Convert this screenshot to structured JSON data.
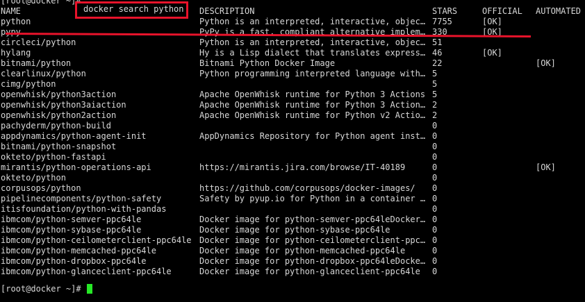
{
  "terminal": {
    "top_prompt": "[root@docker ~]#",
    "command": "docker search python",
    "final_prompt": "[root@docker ~]#"
  },
  "table": {
    "headers": {
      "name": "NAME",
      "description": "DESCRIPTION",
      "stars": "STARS",
      "official": "OFFICIAL",
      "automated": "AUTOMATED"
    },
    "rows": [
      {
        "name": "python",
        "description": "Python is an interpreted, interactive, objec…",
        "stars": "7755",
        "official": "[OK]",
        "automated": ""
      },
      {
        "name": "pypy",
        "description": "PyPy is a fast, compliant alternative implem…",
        "stars": "330",
        "official": "[OK]",
        "automated": ""
      },
      {
        "name": "circleci/python",
        "description": "Python is an interpreted, interactive, objec…",
        "stars": "51",
        "official": "",
        "automated": ""
      },
      {
        "name": "hylang",
        "description": "Hy is a Lisp dialect that translates express…",
        "stars": "46",
        "official": "[OK]",
        "automated": ""
      },
      {
        "name": "bitnami/python",
        "description": "Bitnami Python Docker Image",
        "stars": "22",
        "official": "",
        "automated": "[OK]"
      },
      {
        "name": "clearlinux/python",
        "description": "Python programming interpreted language with…",
        "stars": "5",
        "official": "",
        "automated": ""
      },
      {
        "name": "cimg/python",
        "description": "",
        "stars": "5",
        "official": "",
        "automated": ""
      },
      {
        "name": "openwhisk/python3action",
        "description": "Apache OpenWhisk runtime for Python 3 Actions",
        "stars": "5",
        "official": "",
        "automated": ""
      },
      {
        "name": "openwhisk/python3aiaction",
        "description": "Apache OpenWhisk runtime for Python 3 Action…",
        "stars": "2",
        "official": "",
        "automated": ""
      },
      {
        "name": "openwhisk/python2action",
        "description": "Apache OpenWhisk runtime for Python v2 Actio…",
        "stars": "2",
        "official": "",
        "automated": ""
      },
      {
        "name": "pachyderm/python-build",
        "description": "",
        "stars": "0",
        "official": "",
        "automated": ""
      },
      {
        "name": "appdynamics/python-agent-init",
        "description": "AppDynamics Repository for Python agent inst…",
        "stars": "0",
        "official": "",
        "automated": ""
      },
      {
        "name": "bitnami/python-snapshot",
        "description": "",
        "stars": "0",
        "official": "",
        "automated": ""
      },
      {
        "name": "okteto/python-fastapi",
        "description": "",
        "stars": "0",
        "official": "",
        "automated": ""
      },
      {
        "name": "mirantis/python-operations-api",
        "description": "https://mirantis.jira.com/browse/IT-40189",
        "stars": "0",
        "official": "",
        "automated": "[OK]"
      },
      {
        "name": "okteto/python",
        "description": "",
        "stars": "0",
        "official": "",
        "automated": ""
      },
      {
        "name": "corpusops/python",
        "description": "https://github.com/corpusops/docker-images/",
        "stars": "0",
        "official": "",
        "automated": ""
      },
      {
        "name": "pipelinecomponents/python-safety",
        "description": "Safety by pyup.io for Python in a container …",
        "stars": "0",
        "official": "",
        "automated": ""
      },
      {
        "name": "itisfoundation/python-with-pandas",
        "description": "",
        "stars": "0",
        "official": "",
        "automated": ""
      },
      {
        "name": "ibmcom/python-semver-ppc64le",
        "description": "Docker image for python-semver-ppc64leDocker…",
        "stars": "0",
        "official": "",
        "automated": ""
      },
      {
        "name": "ibmcom/python-sybase-ppc64le",
        "description": "Docker image for python-sybase-ppc64le",
        "stars": "0",
        "official": "",
        "automated": ""
      },
      {
        "name": "ibmcom/python-ceilometerclient-ppc64le",
        "description": "Docker image for python-ceilometerclient-ppc…",
        "stars": "0",
        "official": "",
        "automated": ""
      },
      {
        "name": "ibmcom/python-memcached-ppc64le",
        "description": "Docker image for python-memcached-ppc64le",
        "stars": "0",
        "official": "",
        "automated": ""
      },
      {
        "name": "ibmcom/python-dropbox-ppc64le",
        "description": "Docker image for python-dropbox-ppc64leDocke…",
        "stars": "0",
        "official": "",
        "automated": ""
      },
      {
        "name": "ibmcom/python-glanceclient-ppc64le",
        "description": "Docker image for python-glanceclient-ppc64le",
        "stars": "0",
        "official": "",
        "automated": ""
      }
    ]
  },
  "colors": {
    "background": "#000000",
    "text": "#d8d8d8",
    "annotation_red": "#e8132b",
    "cursor_green": "#26e826"
  }
}
